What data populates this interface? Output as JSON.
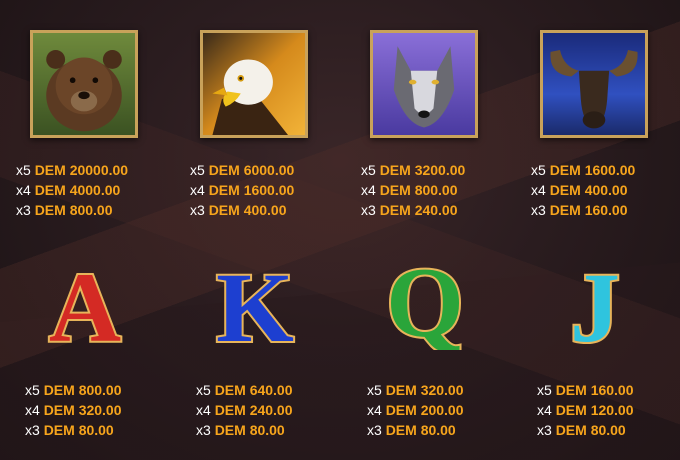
{
  "symbols": [
    {
      "name": "Bear",
      "icon": "bear-icon",
      "pays": [
        {
          "mult": "x5",
          "amount": "DEM 20000.00"
        },
        {
          "mult": "x4",
          "amount": "DEM 4000.00"
        },
        {
          "mult": "x3",
          "amount": "DEM 800.00"
        }
      ]
    },
    {
      "name": "Eagle",
      "icon": "eagle-icon",
      "pays": [
        {
          "mult": "x5",
          "amount": "DEM 6000.00"
        },
        {
          "mult": "x4",
          "amount": "DEM 1600.00"
        },
        {
          "mult": "x3",
          "amount": "DEM 400.00"
        }
      ]
    },
    {
      "name": "Wolf",
      "icon": "wolf-icon",
      "pays": [
        {
          "mult": "x5",
          "amount": "DEM 3200.00"
        },
        {
          "mult": "x4",
          "amount": "DEM 800.00"
        },
        {
          "mult": "x3",
          "amount": "DEM 240.00"
        }
      ]
    },
    {
      "name": "Moose",
      "icon": "moose-icon",
      "pays": [
        {
          "mult": "x5",
          "amount": "DEM 1600.00"
        },
        {
          "mult": "x4",
          "amount": "DEM 400.00"
        },
        {
          "mult": "x3",
          "amount": "DEM 160.00"
        }
      ]
    },
    {
      "letter": "A",
      "color": "#d42a24",
      "pays": [
        {
          "mult": "x5",
          "amount": "DEM 800.00"
        },
        {
          "mult": "x4",
          "amount": "DEM 320.00"
        },
        {
          "mult": "x3",
          "amount": "DEM 80.00"
        }
      ]
    },
    {
      "letter": "K",
      "color": "#1d3fd0",
      "pays": [
        {
          "mult": "x5",
          "amount": "DEM 640.00"
        },
        {
          "mult": "x4",
          "amount": "DEM 240.00"
        },
        {
          "mult": "x3",
          "amount": "DEM 80.00"
        }
      ]
    },
    {
      "letter": "Q",
      "color": "#2aa53a",
      "pays": [
        {
          "mult": "x5",
          "amount": "DEM 320.00"
        },
        {
          "mult": "x4",
          "amount": "DEM 200.00"
        },
        {
          "mult": "x3",
          "amount": "DEM 80.00"
        }
      ]
    },
    {
      "letter": "J",
      "color": "#2fc4de",
      "pays": [
        {
          "mult": "x5",
          "amount": "DEM 160.00"
        },
        {
          "mult": "x4",
          "amount": "DEM 120.00"
        },
        {
          "mult": "x3",
          "amount": "DEM 80.00"
        }
      ]
    }
  ],
  "colors": {
    "amount": "#f7a51c",
    "multiplier": "#ffffff",
    "frame": "#c9a25a"
  }
}
